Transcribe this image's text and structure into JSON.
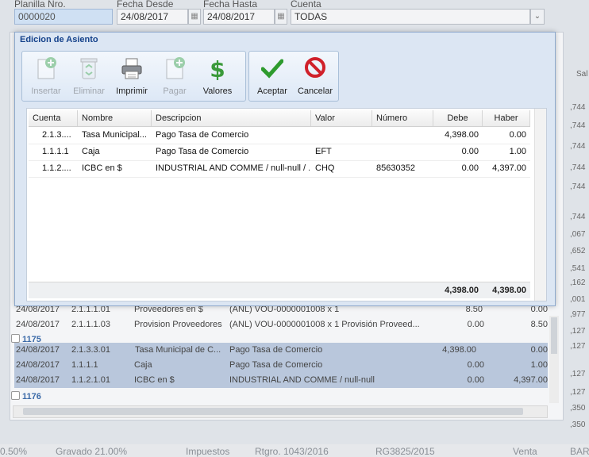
{
  "filters": {
    "planilla_label": "Planilla Nro.",
    "planilla_value": "0000020",
    "desde_label": "Fecha Desde",
    "desde_value": "24/08/2017",
    "hasta_label": "Fecha Hasta",
    "hasta_value": "24/08/2017",
    "cuenta_label": "Cuenta",
    "cuenta_value": "TODAS"
  },
  "modal": {
    "title": "Edicion de Asiento",
    "toolbar": {
      "insertar": "Insertar",
      "eliminar": "Eliminar",
      "imprimir": "Imprimir",
      "pagar": "Pagar",
      "valores": "Valores",
      "aceptar": "Aceptar",
      "cancelar": "Cancelar"
    },
    "columns": [
      "Cuenta",
      "Nombre",
      "Descripcion",
      "Valor",
      "Número",
      "Debe",
      "Haber"
    ],
    "rows": [
      [
        "2.1.3....",
        "Tasa Municipal...",
        "Pago Tasa de Comercio",
        "",
        "",
        "4,398.00",
        "0.00"
      ],
      [
        "1.1.1.1",
        "Caja",
        "Pago Tasa de Comercio",
        "EFT",
        "",
        "0.00",
        "1.00"
      ],
      [
        "1.1.2....",
        "ICBC en $",
        "INDUSTRIAL AND COMME / null-null / ...",
        "CHQ",
        "85630352",
        "0.00",
        "4,397.00"
      ]
    ],
    "totals": {
      "debe": "4,398.00",
      "haber": "4,398.00"
    }
  },
  "background_grid": {
    "partial_row": [
      "24/08/2017",
      "2.1.1.1.01",
      "Proveedores en $",
      "(ANL) VOU-0000001008 x 1",
      "8.50",
      "0.00"
    ],
    "rows_a": [
      [
        "24/08/2017",
        "2.1.1.1.03",
        "Provision Proveedores",
        "(ANL) VOU-0000001008 x 1 Provisión Proveed...",
        "0.00",
        "8.50"
      ]
    ],
    "group_1175": "1175",
    "rows_b": [
      [
        "24/08/2017",
        "2.1.3.3.01",
        "Tasa Municipal de C...",
        "Pago Tasa de Comercio",
        "4,398.00",
        "0.00"
      ],
      [
        "24/08/2017",
        "1.1.1.1",
        "Caja",
        "Pago Tasa de Comercio",
        "0.00",
        "1.00"
      ],
      [
        "24/08/2017",
        "1.1.2.1.01",
        "ICBC en $",
        "INDUSTRIAL AND COMME / null-null",
        "0.00",
        "4,397.00"
      ]
    ],
    "group_1176": "1176",
    "right_header": "Sal",
    "right_values": [
      ",744",
      ",744",
      ",744",
      ",744",
      ",744",
      ",744",
      ",067",
      ",652",
      ",541",
      ",162",
      ",001",
      ",977",
      ",127",
      ",127",
      ",127",
      ",127",
      ",350",
      ",350"
    ]
  },
  "status_bar": {
    "items": [
      "0.50%",
      "Gravado 21.00%",
      "Impuestos",
      "Rtgro. 1043/2016",
      "RG3825/2015",
      "Venta",
      "BAR"
    ]
  }
}
